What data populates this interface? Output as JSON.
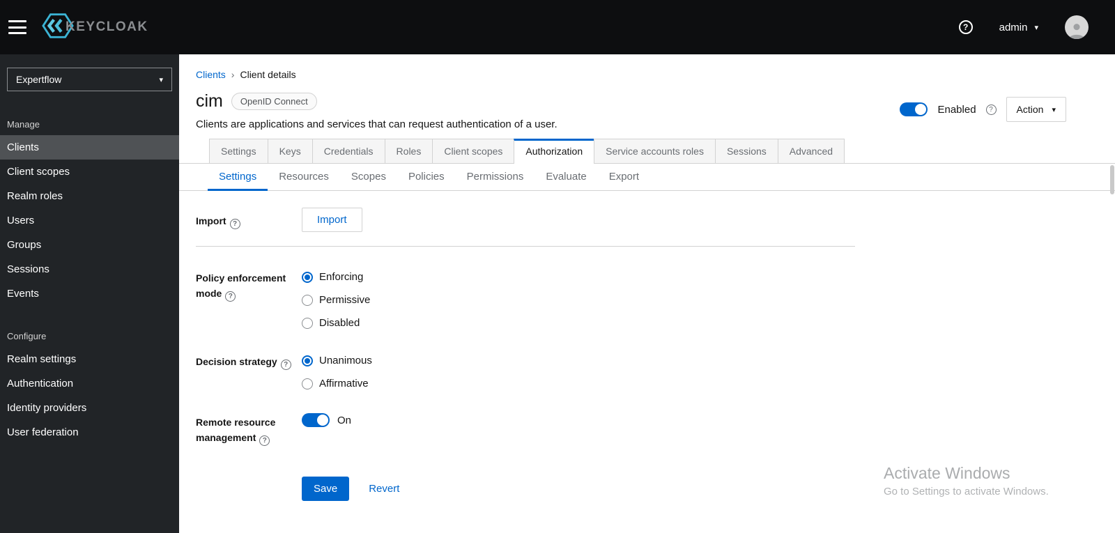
{
  "topbar": {
    "brand": "KEYCLOAK",
    "user": "admin"
  },
  "sidebar": {
    "realm": "Expertflow",
    "manage_label": "Manage",
    "manage_items": [
      "Clients",
      "Client scopes",
      "Realm roles",
      "Users",
      "Groups",
      "Sessions",
      "Events"
    ],
    "configure_label": "Configure",
    "configure_items": [
      "Realm settings",
      "Authentication",
      "Identity providers",
      "User federation"
    ],
    "active_item": "Clients"
  },
  "breadcrumb": {
    "parent": "Clients",
    "current": "Client details"
  },
  "header": {
    "title": "cim",
    "protocol_badge": "OpenID Connect",
    "description": "Clients are applications and services that can request authentication of a user.",
    "enabled_label": "Enabled",
    "action_label": "Action"
  },
  "tabs": [
    "Settings",
    "Keys",
    "Credentials",
    "Roles",
    "Client scopes",
    "Authorization",
    "Service accounts roles",
    "Sessions",
    "Advanced"
  ],
  "active_tab": "Authorization",
  "subtabs": [
    "Settings",
    "Resources",
    "Scopes",
    "Policies",
    "Permissions",
    "Evaluate",
    "Export"
  ],
  "active_subtab": "Settings",
  "form": {
    "import_label": "Import",
    "import_button": "Import",
    "policy_label": "Policy enforcement mode",
    "policy_options": [
      "Enforcing",
      "Permissive",
      "Disabled"
    ],
    "policy_selected": "Enforcing",
    "decision_label": "Decision strategy",
    "decision_options": [
      "Unanimous",
      "Affirmative"
    ],
    "decision_selected": "Unanimous",
    "remote_label": "Remote resource management",
    "remote_state": "On",
    "save": "Save",
    "revert": "Revert"
  },
  "watermark": {
    "line1": "Activate Windows",
    "line2": "Go to Settings to activate Windows."
  },
  "icons": {
    "caret_down": "▾",
    "help": "?",
    "separator": "›"
  },
  "colors": {
    "accent": "#0066cc",
    "topbar_bg": "#0d0e10",
    "sidebar_bg": "#212427",
    "sidebar_active_bg": "#4f5255",
    "logo_cyan": "#3bb3d4"
  }
}
